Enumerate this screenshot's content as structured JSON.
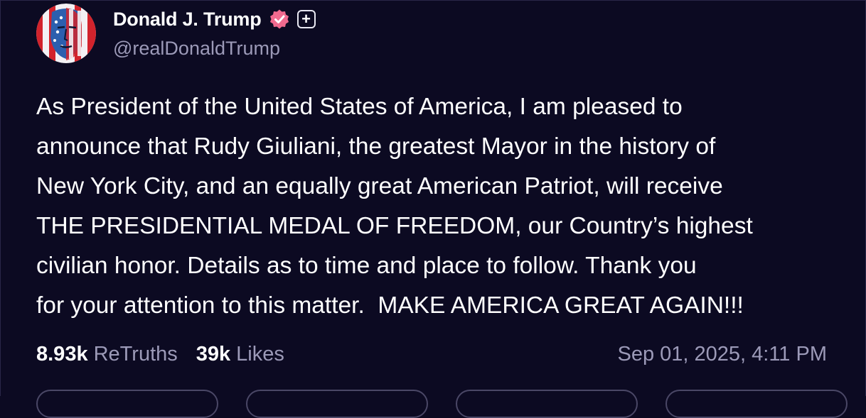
{
  "post": {
    "author": {
      "display_name": "Donald J. Trump",
      "handle": "@realDonaldTrump",
      "verified_icon": "verified-badge-icon",
      "plus_badge": "+"
    },
    "body": "As President of the United States of America, I am pleased to\nannounce that Rudy Giuliani, the greatest Mayor in the history of\nNew York City, and an equally great American Patriot, will receive\nTHE PRESIDENTIAL MEDAL OF FREEDOM, our Country’s highest\ncivilian honor. Details as to time and place to follow. Thank you\nfor your attention to this matter.  MAKE AMERICA GREAT AGAIN!!!",
    "stats": {
      "retruths_count": "8.93k",
      "retruths_label": "ReTruths",
      "likes_count": "39k",
      "likes_label": "Likes"
    },
    "timestamp": "Sep 01, 2025, 4:11 PM"
  },
  "colors": {
    "background": "#0c0a22",
    "muted_text": "#9c9ab8",
    "verified": "#f06a8f"
  }
}
